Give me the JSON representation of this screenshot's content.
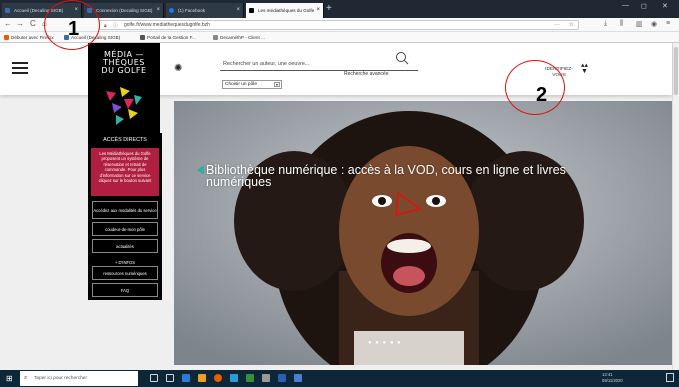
{
  "browser": {
    "tabs": [
      {
        "label": "Accueil (Decaling SIGB)"
      },
      {
        "label": "Connexion (Decaling SIGB)"
      },
      {
        "label": "(1) Facebook"
      },
      {
        "label": "Les médiathèques du Golfe"
      }
    ],
    "new_tab": "+",
    "window_controls": [
      "—",
      "◻",
      "✕"
    ],
    "nav": {
      "back": "←",
      "forward": "→",
      "reload": "C",
      "home": "⌂"
    },
    "url": "golfe.fr/www.mediathequesdugolfe.bzh",
    "url_menu": "···",
    "bookmark_star": "☆",
    "bookmarks": [
      {
        "label": "Débuter avec Firefox",
        "color": "#e66000"
      },
      {
        "label": "Accueil (Decaling SIGB)",
        "color": "#3a6ea5"
      },
      {
        "label": "Portail de la Gestion F...",
        "color": "#555555"
      },
      {
        "label": "DecaméthP - Client ...",
        "color": "#888888"
      }
    ]
  },
  "site": {
    "logo_text": "MÉDIA —\nTHÈQUES\nDU GOLFE",
    "search_placeholder": "Rechercher un auteur, une oeuvre...",
    "advanced_search": "Recherche avancée",
    "pole_select": "Choisir un pôle",
    "identify": "IDENTIFIEZ-\nVOUS",
    "sidebar": {
      "title": "ACCÈS DIRECTS",
      "highlight": "Les Médiathèques du Golfe proposent un système de réservation et retrait de commande. Pour plus d'information sur ce service cliquez sur le bouton suivant",
      "buttons": [
        {
          "label": "Accédez aux modalités du service"
        },
        {
          "label": "coudeur-de-mon pôle"
        },
        {
          "label": "actualités"
        },
        {
          "label": "+ D'INFOS"
        },
        {
          "label": "ressources numériques"
        },
        {
          "label": "FAQ"
        }
      ]
    },
    "hero": {
      "caption": "Bibliothèque numérique : accès à la VOD, cours en ligne et livres numériques",
      "slide_dots": "● ● ● ● ●"
    }
  },
  "annotations": [
    {
      "label": "1"
    },
    {
      "label": "2"
    }
  ],
  "taskbar": {
    "start": "⊞",
    "search_placeholder": "Taper ici pour rechercher",
    "tray_time": "13:41",
    "tray_date": "09/11/2020"
  },
  "colors": {
    "accent_red": "#b01e40",
    "annotation_red": "#e01010",
    "logo_bg": "#000000"
  }
}
